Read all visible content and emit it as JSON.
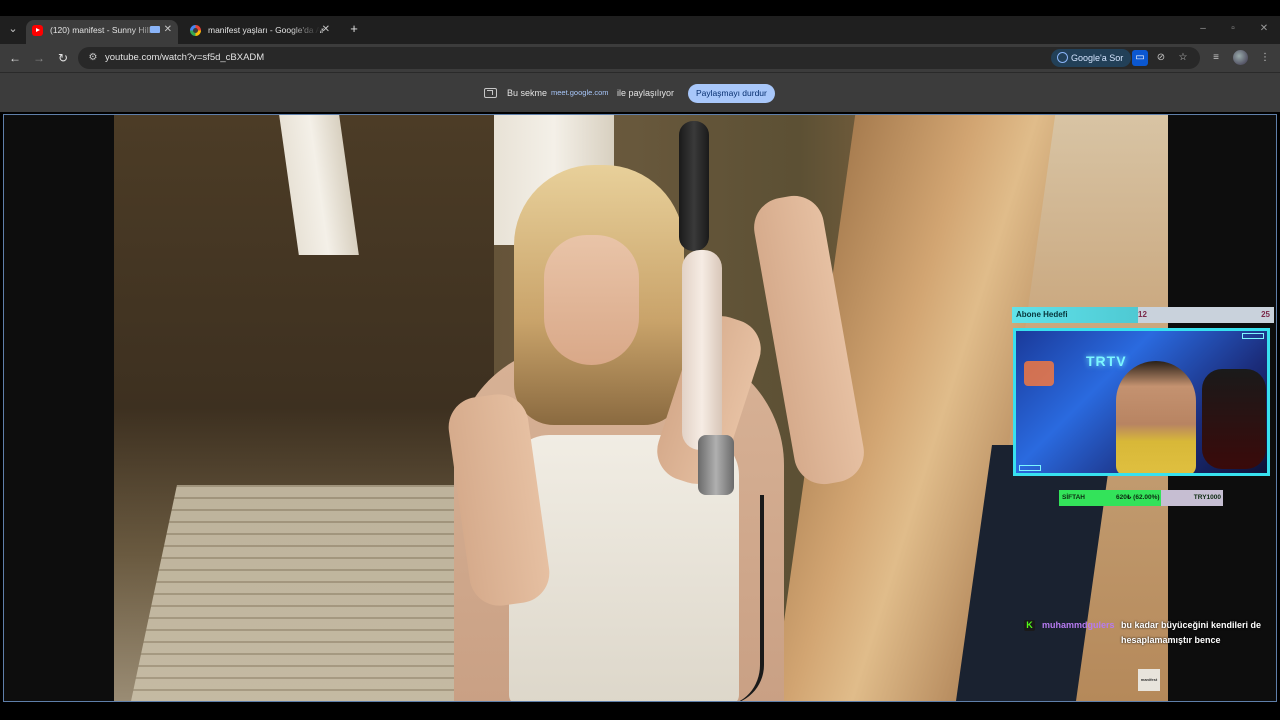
{
  "browser": {
    "tabs": [
      {
        "title": "(120) manifest - Sunny Hill",
        "favicon": "youtube-icon",
        "active": true
      },
      {
        "title": "manifest yaşları - Google'da Ar",
        "favicon": "google-icon",
        "active": false
      }
    ],
    "address": "youtube.com/watch?v=sf5d_cBXADM",
    "google_button": "Google'a Sor"
  },
  "share_bar": {
    "prefix": "Bu sekme",
    "domain": "meet.google.com",
    "suffix": "ile paylaşılıyor",
    "stop_button": "Paylaşmayı durdur"
  },
  "stream_overlay": {
    "subscriber_goal": {
      "label": "Abone Hedefi",
      "current": "12",
      "target": "25",
      "fraction": 0.48
    },
    "cam_sign": "TRTV",
    "goal_progress": {
      "left": "SİFTAH",
      "middle": "620₺ (62.00%)",
      "right": "TRY1000",
      "fraction": 0.62
    },
    "chat": {
      "username": "muhammdgulers",
      "message": "bu kadar büyüceğini kendileri de hesaplamamıştır bence"
    },
    "badge_text": "manifest"
  },
  "colors": {
    "accent_cyan": "#38e1ef",
    "progress_green": "#33e35a",
    "chat_username": "#b67af0",
    "stop_button": "#a8c7fa"
  }
}
